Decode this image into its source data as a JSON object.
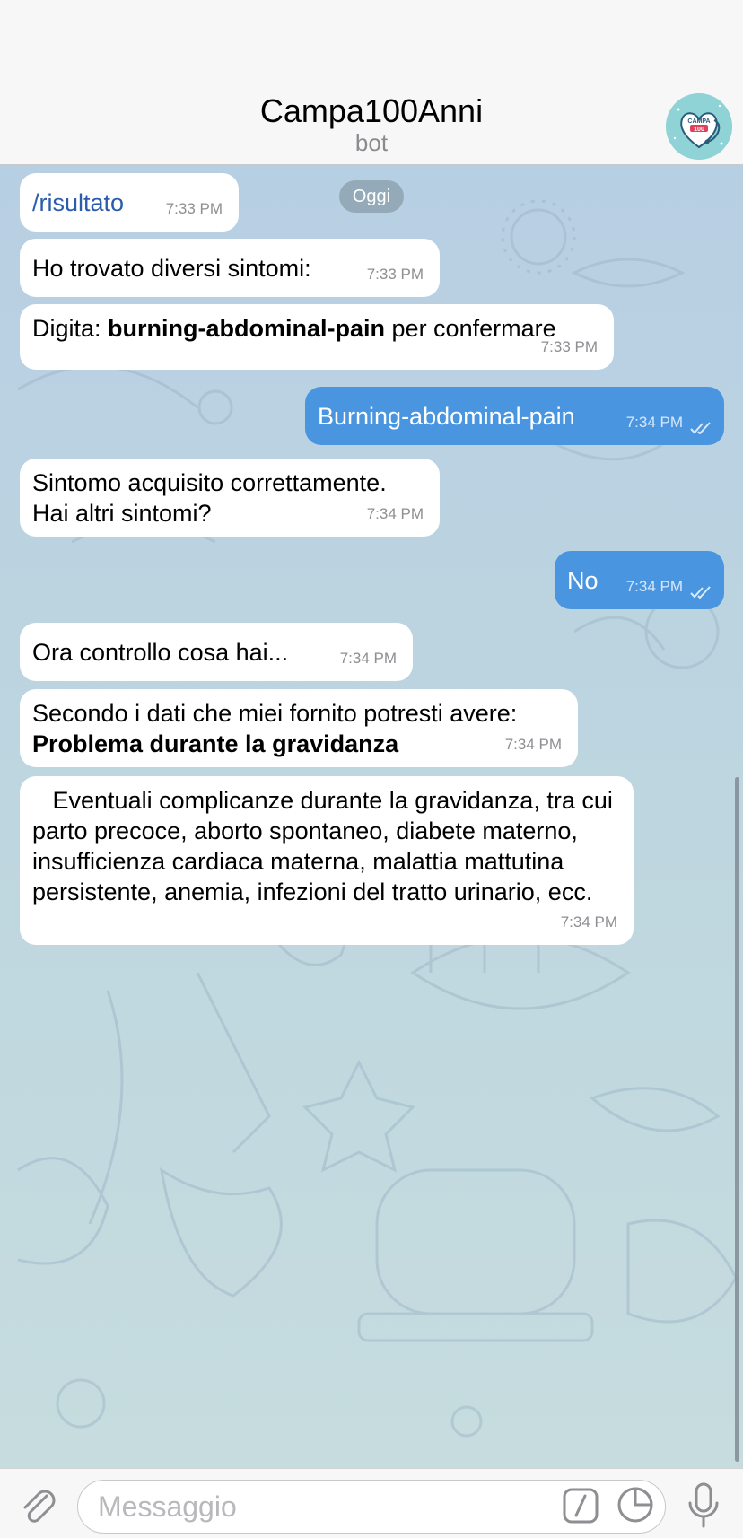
{
  "header": {
    "title": "Campa100Anni",
    "subtitle": "bot",
    "avatar_text_top": "CAMPA",
    "avatar_text_mid": "100"
  },
  "chat": {
    "date_label": "Oggi",
    "messages": [
      {
        "dir": "in",
        "text": "/risultato",
        "time": "7:33 PM"
      },
      {
        "dir": "in",
        "text": "Ho trovato diversi sintomi:",
        "time": "7:33 PM"
      },
      {
        "dir": "in",
        "prefix": "Digita: ",
        "bold": "burning-abdominal-pain",
        "suffix": " per confermare",
        "time": "7:33 PM"
      },
      {
        "dir": "out",
        "text": "Burning-abdominal-pain",
        "time": "7:34 PM"
      },
      {
        "dir": "in",
        "line1": "Sintomo acquisito correttamente.",
        "line2": "Hai altri sintomi?",
        "time": "7:34 PM"
      },
      {
        "dir": "out",
        "text": "No",
        "time": "7:34 PM"
      },
      {
        "dir": "in",
        "text": "Ora controllo cosa hai...",
        "time": "7:34 PM"
      },
      {
        "dir": "in",
        "line1": "Secondo i dati che miei fornito potresti avere:",
        "bold": "Problema durante la gravidanza",
        "time": "7:34 PM"
      },
      {
        "dir": "in",
        "text": "   Eventuali complicanze durante la gravidanza, tra cui parto precoce, aborto spontaneo, diabete materno, insufficienza cardiaca materna, malattia mattutina persistente, anemia, infezioni del tratto urinario, ecc.",
        "time": "7:34 PM"
      }
    ]
  },
  "input": {
    "placeholder": "Messaggio"
  },
  "colors": {
    "outgoing_bubble": "#4a95e0",
    "incoming_bubble": "#ffffff",
    "command_link": "#2a5dab"
  }
}
